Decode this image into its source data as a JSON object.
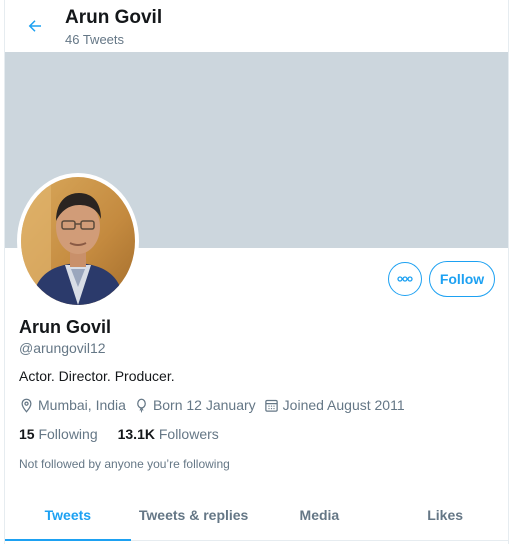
{
  "header": {
    "title": "Arun Govil",
    "tweet_count": "46 Tweets",
    "back_icon": "back-arrow-icon"
  },
  "profile": {
    "name": "Arun Govil",
    "handle": "@arungovil12",
    "bio": "Actor. Director. Producer.",
    "location": "Mumbai, India",
    "born": "Born 12 January",
    "joined": "Joined August 2011",
    "following_count": "15",
    "following_label": "Following",
    "followers_count": "13.1K",
    "followers_label": "Followers",
    "not_followed": "Not followed by anyone you’re following"
  },
  "actions": {
    "follow_label": "Follow",
    "more_icon": "more-icon"
  },
  "tabs": [
    {
      "label": "Tweets",
      "active": true
    },
    {
      "label": "Tweets & replies",
      "active": false
    },
    {
      "label": "Media",
      "active": false
    },
    {
      "label": "Likes",
      "active": false
    }
  ],
  "colors": {
    "accent": "#1da1f2",
    "banner": "#ccd6dd",
    "secondary_text": "#657786"
  }
}
